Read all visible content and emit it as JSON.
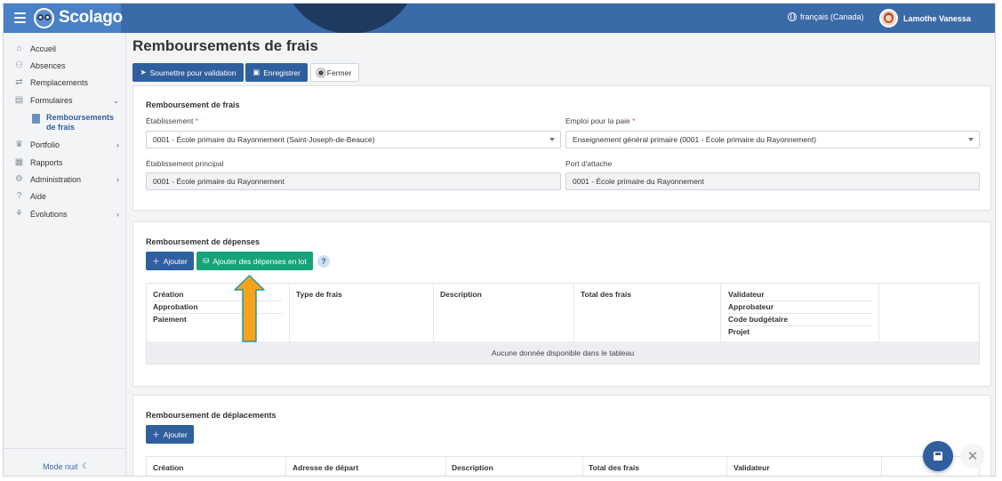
{
  "app": {
    "brand": "Scolago"
  },
  "header": {
    "language": "français (Canada)",
    "user_name": "Lamothe Vanessa"
  },
  "sidebar": {
    "items": [
      {
        "label": "Accueil",
        "icon": "home-icon"
      },
      {
        "label": "Absences",
        "icon": "users-icon"
      },
      {
        "label": "Remplacements",
        "icon": "swap-icon"
      },
      {
        "label": "Formulaires",
        "icon": "form-icon",
        "expanded": true
      },
      {
        "label": "Portfolio",
        "icon": "trophy-icon"
      },
      {
        "label": "Rapports",
        "icon": "report-icon"
      },
      {
        "label": "Administration",
        "icon": "gear-icon"
      },
      {
        "label": "Aide",
        "icon": "question-icon"
      },
      {
        "label": "Évolutions",
        "icon": "sprout-icon"
      }
    ],
    "sub_item": {
      "line1": "Remboursements",
      "line2": "de frais"
    },
    "night_mode": "Mode nuit"
  },
  "page": {
    "title": "Remboursements de frais",
    "toolbar": {
      "submit": "Soumettre pour validation",
      "save": "Enregistrer",
      "close": "Fermer"
    }
  },
  "form": {
    "section_title": "Remboursement de frais",
    "etablissement_label": "Établissement",
    "etablissement_value": "0001 - École primaire du Rayonnement (Saint-Joseph-de-Beauce)",
    "emploi_label": "Emploi pour la paie",
    "emploi_value": "Enseignement général primaire (0001 - École primaire du Rayonnement)",
    "etab_principal_label": "Établissement principal",
    "etab_principal_value": "0001 - École primaire du Rayonnement",
    "port_label": "Port d'attache",
    "port_value": "0001 - École primaire du Rayonnement",
    "required_mark": "*"
  },
  "depenses": {
    "section_title": "Remboursement de dépenses",
    "add_label": "Ajouter",
    "batch_label": "Ajouter des dépenses en lot",
    "help": "?",
    "columns": {
      "col1": [
        "Création",
        "Approbation",
        "Paiement"
      ],
      "col2": "Type de frais",
      "col3": "Description",
      "col4": "Total des frais",
      "col5": [
        "Validateur",
        "Approbateur",
        "Code budgétaire",
        "Projet"
      ]
    },
    "empty": "Aucune donnée disponible dans le tableau"
  },
  "deplacements": {
    "section_title": "Remboursement de déplacements",
    "add_label": "Ajouter",
    "columns": [
      "Création",
      "Adresse de départ",
      "Description",
      "Total des frais",
      "Validateur"
    ]
  },
  "colors": {
    "primary": "#2f5f9e",
    "topbar": "#3a6aa8",
    "green": "#16a37a",
    "arrow": "#f7a21b",
    "arrow_outline": "#1e9aa3"
  }
}
